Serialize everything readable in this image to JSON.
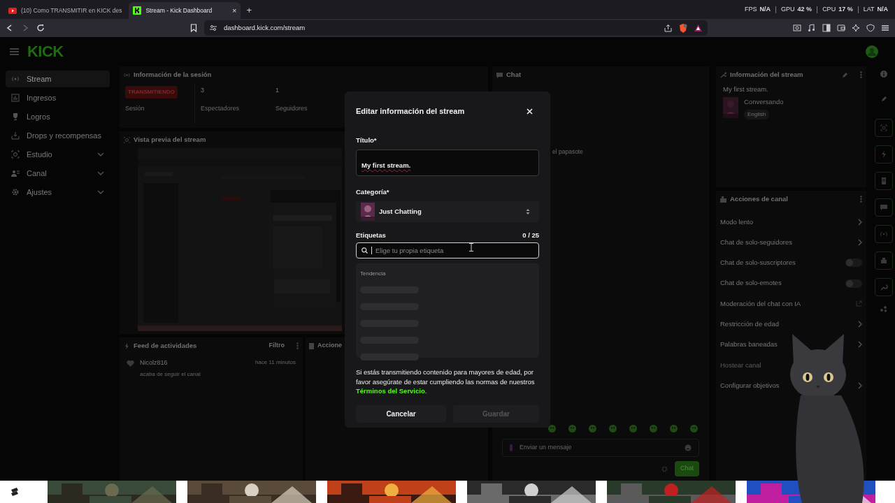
{
  "browser": {
    "tabs": [
      {
        "title": "(10) Como TRANSMITIR en KICK des",
        "selected": false,
        "kind": "video"
      },
      {
        "title": "Stream - Kick Dashboard",
        "selected": true,
        "kind": "kick",
        "close": "×"
      }
    ],
    "new_tab": "+",
    "stats": [
      {
        "label": "FPS",
        "value": "N/A"
      },
      {
        "label": "GPU",
        "value": "42 %"
      },
      {
        "label": "CPU",
        "value": "17 %"
      },
      {
        "label": "LAT",
        "value": "N/A"
      }
    ],
    "url": "dashboard.kick.com/stream",
    "forward_disabled": true
  },
  "logo": "KICK",
  "sidebar": {
    "items": [
      {
        "label": "Stream",
        "selected": true,
        "expandable": false
      },
      {
        "label": "Ingresos",
        "selected": false,
        "expandable": false
      },
      {
        "label": "Logros",
        "selected": false,
        "expandable": false
      },
      {
        "label": "Drops y recompensas",
        "selected": false,
        "expandable": false
      },
      {
        "label": "Estudio",
        "selected": false,
        "expandable": true
      },
      {
        "label": "Canal",
        "selected": false,
        "expandable": true
      },
      {
        "label": "Ajustes",
        "selected": false,
        "expandable": true
      }
    ]
  },
  "session": {
    "title": "Información de la sesión",
    "status": "TRANSMITIENDO",
    "status_label": "Sesión",
    "stats": [
      {
        "value": "3",
        "label": "Espectadores"
      },
      {
        "value": "1",
        "label": "Seguidores"
      }
    ]
  },
  "preview": {
    "title": "Vista previa del stream"
  },
  "feed": {
    "title": "Feed de actividades",
    "filter": "Filtro",
    "events": [
      {
        "user": "Nicolz816",
        "time": "hace 11 minutos",
        "text": "acaba de seguir el canal"
      }
    ]
  },
  "actions_panel": {
    "title": "Accione"
  },
  "chat": {
    "title": "Chat",
    "messages": [
      "el papasote"
    ],
    "placeholder": "Enviar un mensaje",
    "send": "Chat"
  },
  "stream_info": {
    "title": "Información del stream",
    "stream_title": "My first stream.",
    "category": "Conversando",
    "language": "English"
  },
  "channel_actions": {
    "title": "Acciones de canal",
    "items": [
      {
        "label": "Modo lento",
        "kind": "link"
      },
      {
        "label": "Chat de solo-seguidores",
        "kind": "link"
      },
      {
        "label": "Chat de solo-suscriptores",
        "kind": "toggle",
        "on": false
      },
      {
        "label": "Chat de solo-emotes",
        "kind": "toggle",
        "on": false
      },
      {
        "label": "Moderación del chat con IA",
        "kind": "external"
      },
      {
        "label": "Restricción de edad",
        "kind": "link"
      },
      {
        "label": "Palabras baneadas",
        "kind": "link"
      },
      {
        "label": "Hostear canal",
        "kind": "disabled"
      },
      {
        "label": "Configurar objetivos",
        "kind": "link"
      }
    ]
  },
  "modal": {
    "title": "Editar información del stream",
    "title_label": "Título*",
    "title_value": "My first stream.",
    "category_label": "Categoría*",
    "category": "Just Chatting",
    "tags_label": "Etiquetas",
    "tags_count": "0 / 25",
    "tags_placeholder": "Elige tu propia etiqueta",
    "suggestions_heading": "Tendencia",
    "notice": "Si estás transmitiendo contenido para mayores de edad, por favor asegúrate de estar cumpliendo las normas de nuestros **Términos del Servicio**.",
    "cancel": "Cancelar",
    "save": "Guardar",
    "save_disabled": true
  }
}
